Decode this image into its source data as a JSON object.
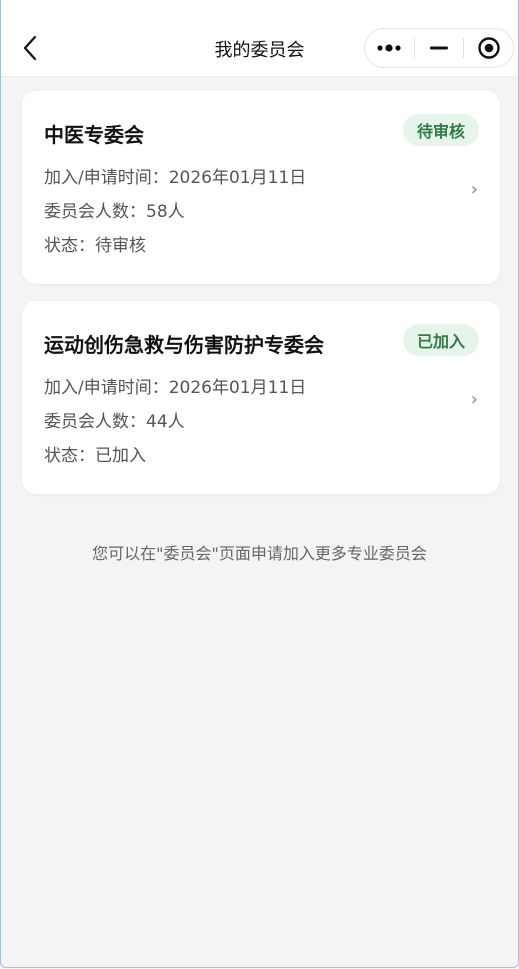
{
  "header": {
    "title": "我的委员会",
    "back_icon": "chevron-left-icon",
    "capsule": {
      "more_icon": "more-dots-icon",
      "minimize_icon": "minus-icon",
      "close_icon": "target-circle-icon"
    }
  },
  "committees": [
    {
      "name": "中医专委会",
      "badge": "待审核",
      "join_time": "加入/申请时间：2026年01月11日",
      "member_count": "委员会人数：58人",
      "status": "状态：待审核"
    },
    {
      "name": "运动创伤急救与伤害防护专委会",
      "badge": "已加入",
      "join_time": "加入/申请时间：2026年01月11日",
      "member_count": "委员会人数：44人",
      "status": "状态：已加入"
    }
  ],
  "chevron": "›",
  "footer_tip": "您可以在\"委员会\"页面申请加入更多专业委员会",
  "colors": {
    "badge_bg": "#e6f4ea",
    "badge_text": "#2e7d46",
    "page_bg": "#f4f4f4"
  }
}
